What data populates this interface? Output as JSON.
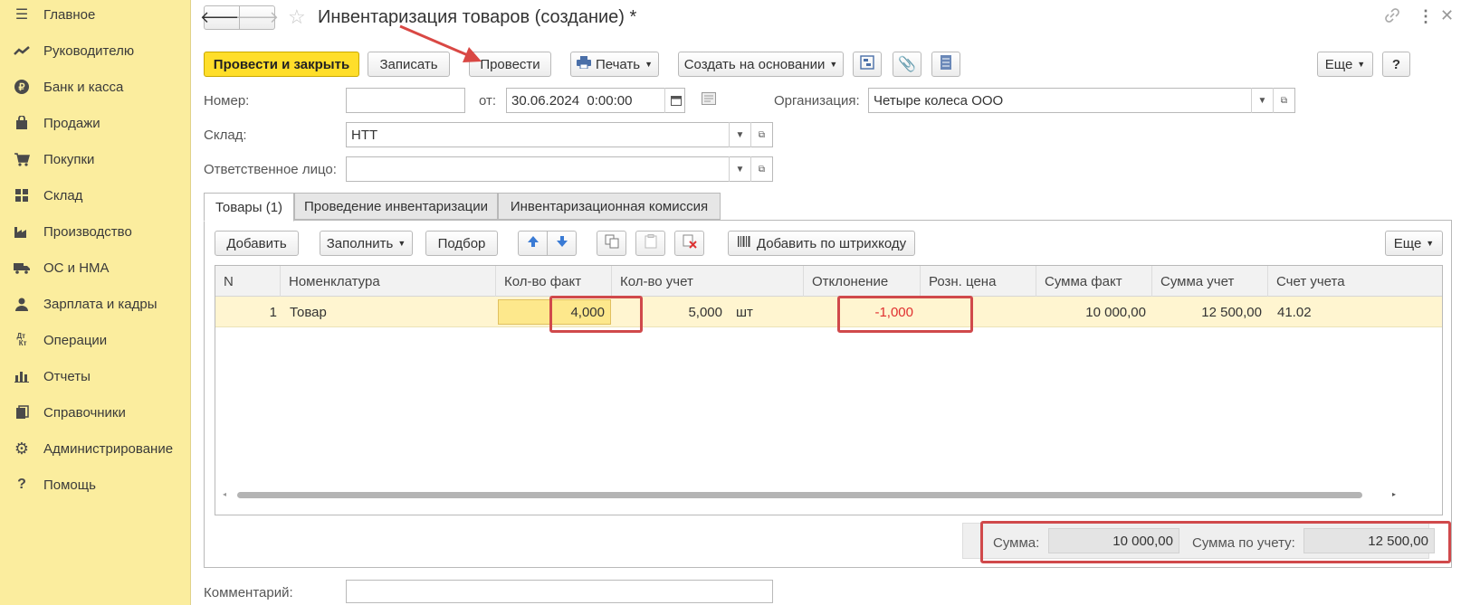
{
  "sidebar": {
    "items": [
      {
        "label": "Главное",
        "icon": "menu-icon"
      },
      {
        "label": "Руководителю",
        "icon": "trend-icon"
      },
      {
        "label": "Банк и касса",
        "icon": "ruble-icon"
      },
      {
        "label": "Продажи",
        "icon": "bag-icon"
      },
      {
        "label": "Покупки",
        "icon": "cart-icon"
      },
      {
        "label": "Склад",
        "icon": "warehouse-icon"
      },
      {
        "label": "Производство",
        "icon": "factory-icon"
      },
      {
        "label": "ОС и НМА",
        "icon": "truck-icon"
      },
      {
        "label": "Зарплата и кадры",
        "icon": "person-icon"
      },
      {
        "label": "Операции",
        "icon": "dt-kt-icon"
      },
      {
        "label": "Отчеты",
        "icon": "bar-chart-icon"
      },
      {
        "label": "Справочники",
        "icon": "books-icon"
      },
      {
        "label": "Администрирование",
        "icon": "gear-icon"
      },
      {
        "label": "Помощь",
        "icon": "question-icon"
      }
    ]
  },
  "header": {
    "title": "Инвентаризация товаров (создание) *"
  },
  "toolbar": {
    "post_close": "Провести и закрыть",
    "save": "Записать",
    "post": "Провести",
    "print": "Печать",
    "create_based": "Создать на основании",
    "more": "Еще",
    "help": "?"
  },
  "form": {
    "number_label": "Номер:",
    "number_value": "",
    "date_label": "от:",
    "date_value": "30.06.2024  0:00:00",
    "org_label": "Организация:",
    "org_value": "Четыре колеса ООО",
    "warehouse_label": "Склад:",
    "warehouse_value": "НТТ",
    "responsible_label": "Ответственное лицо:",
    "responsible_value": "",
    "comment_label": "Комментарий:",
    "comment_value": ""
  },
  "tabs": [
    {
      "label": "Товары (1)",
      "active": true
    },
    {
      "label": "Проведение инвентаризации",
      "active": false
    },
    {
      "label": "Инвентаризационная комиссия",
      "active": false
    }
  ],
  "table_toolbar": {
    "add": "Добавить",
    "fill": "Заполнить",
    "select": "Подбор",
    "add_barcode": "Добавить по штрихкоду",
    "more": "Еще"
  },
  "table": {
    "columns": [
      "N",
      "Номенклатура",
      "Кол-во факт",
      "Кол-во учет",
      "Отклонение",
      "Розн. цена",
      "Сумма факт",
      "Сумма учет",
      "Счет учета"
    ],
    "rows": [
      {
        "n": "1",
        "item": "Товар",
        "qty_fact": "4,000",
        "qty_account": "5,000",
        "unit": "шт",
        "deviation": "-1,000",
        "retail_price": "",
        "sum_fact": "10 000,00",
        "sum_account": "12 500,00",
        "account": "41.02"
      }
    ]
  },
  "totals": {
    "sum_label": "Сумма:",
    "sum_value": "10 000,00",
    "sum_account_label": "Сумма по учету:",
    "sum_account_value": "12 500,00"
  },
  "colors": {
    "sidebar_bg": "#fbed9e",
    "primary_button": "#ffde2a",
    "row_highlight": "#fff5d0",
    "negative": "#e03030",
    "annotation": "#d0494b"
  }
}
